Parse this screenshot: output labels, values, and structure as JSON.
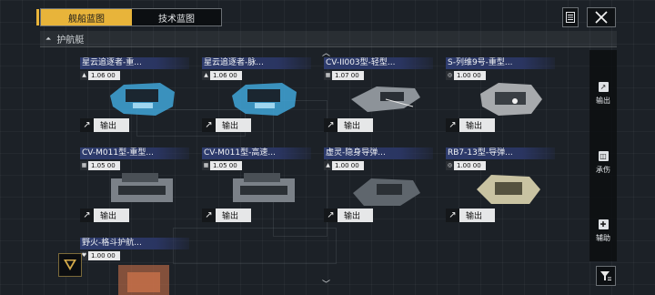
{
  "tabs": [
    {
      "label": "舰船蓝图",
      "active": true
    },
    {
      "label": "技术蓝图",
      "active": false
    }
  ],
  "section": {
    "label": "护航艇"
  },
  "cards": [
    {
      "title": "星云追逐者-重...",
      "value_icon": "▲",
      "value": "1.06  00",
      "export_label": "输出",
      "ship_color": "#3fa4d8"
    },
    {
      "title": "星云追逐者-脉...",
      "value_icon": "▲",
      "value": "1.06  00",
      "export_label": "输出",
      "ship_color": "#3fa4d8"
    },
    {
      "title": "CV-II003型-轻型...",
      "value_icon": "▦",
      "value": "1.07  00",
      "export_label": "输出",
      "ship_color": "#8d9399"
    },
    {
      "title": "S-列维9号-重型...",
      "value_icon": "◎",
      "value": "1.00  00",
      "export_label": "输出",
      "ship_color": "#a7aaad"
    },
    {
      "title": "CV-M011型-重型...",
      "value_icon": "▦",
      "value": "1.05  00",
      "export_label": "输出",
      "ship_color": "#7b8188"
    },
    {
      "title": "CV-M011型-高速...",
      "value_icon": "▦",
      "value": "1.05  00",
      "export_label": "输出",
      "ship_color": "#7b8188"
    },
    {
      "title": "虚灵-隐身导弹...",
      "value_icon": "▲",
      "value": "1.00  00",
      "export_label": "输出",
      "ship_color": "#5f666d"
    },
    {
      "title": "RB7-13型-导弹...",
      "value_icon": "◎",
      "value": "1.00  00",
      "export_label": "输出",
      "ship_color": "#c9c3a2"
    },
    {
      "title": "野火-格斗护航...",
      "value_icon": "♥",
      "value": "1.00  00",
      "export_label": "",
      "ship_color": "#c8704a"
    }
  ],
  "side_buttons": [
    {
      "label": "输出",
      "icon": "export-icon"
    },
    {
      "label": "承伤",
      "icon": "shield-icon"
    },
    {
      "label": "辅助",
      "icon": "support-icon"
    }
  ]
}
